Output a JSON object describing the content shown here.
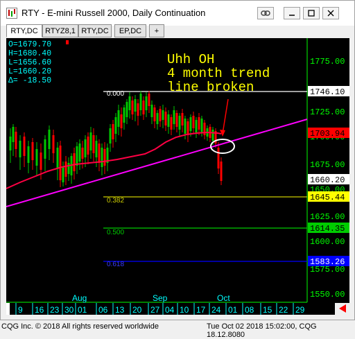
{
  "window": {
    "title": "RTY - E-mini Russell 2000, Daily Continuation"
  },
  "tabs": [
    {
      "label": "RTY,DC",
      "active": true
    },
    {
      "label": "RTYZ8,1",
      "active": false
    },
    {
      "label": "RTY,DC",
      "active": false
    },
    {
      "label": "EP,DC",
      "active": false
    },
    {
      "label": "+",
      "active": false
    }
  ],
  "ohlc": {
    "o": "O=1679.70",
    "h": "H=1680.40",
    "l": "L=1656.60",
    "c": "L=1660.20",
    "d": "Δ= -18.50"
  },
  "annotation": {
    "line1": "Uhh OH",
    "line2": "4 month trend",
    "line3": "line broken"
  },
  "fib": {
    "f0": "0.000",
    "f382": "0.382",
    "f500": "0.500",
    "f618": "0.618"
  },
  "price_axis": {
    "ticks": [
      "1775.00",
      "1725.00",
      "1700.00",
      "1675.00",
      "1650.00",
      "1625.00",
      "1600.00",
      "1575.00",
      "1550.00"
    ],
    "tags": [
      {
        "text": "1746.10",
        "bg": "#ffffff",
        "fg": "#000000"
      },
      {
        "text": "1703.94",
        "bg": "#ff0000",
        "fg": "#000000"
      },
      {
        "text": "1660.20",
        "bg": "#ffffff",
        "fg": "#000000"
      },
      {
        "text": "1645.44",
        "bg": "#ffff00",
        "fg": "#000000"
      },
      {
        "text": "1614.35",
        "bg": "#00cc00",
        "fg": "#000000"
      },
      {
        "text": "1583.26",
        "bg": "#0000ff",
        "fg": "#ffffff"
      }
    ]
  },
  "months": [
    "Aug",
    "Sep",
    "Oct"
  ],
  "dates": [
    "9",
    "16",
    "23",
    "30",
    "01",
    "06",
    "13",
    "20",
    "27",
    "04",
    "10",
    "17",
    "24",
    "01",
    "08",
    "15",
    "22",
    "29"
  ],
  "footer": {
    "left": "CQG Inc. © 2018 All rights reserved worldwide",
    "right": "Tue Oct 02 2018 15:02:00, CQG 18.12.8080"
  },
  "colors": {
    "up_candle": "#00c800",
    "down_candle": "#ff0000",
    "trend_line": "#ff00ff",
    "moving_average": "#ff0044",
    "annotation": "#ffff00",
    "fib_0": "#ffffff",
    "fib_382": "#cccc00",
    "fib_500": "#00cc00",
    "fib_618": "#0000ff"
  }
}
